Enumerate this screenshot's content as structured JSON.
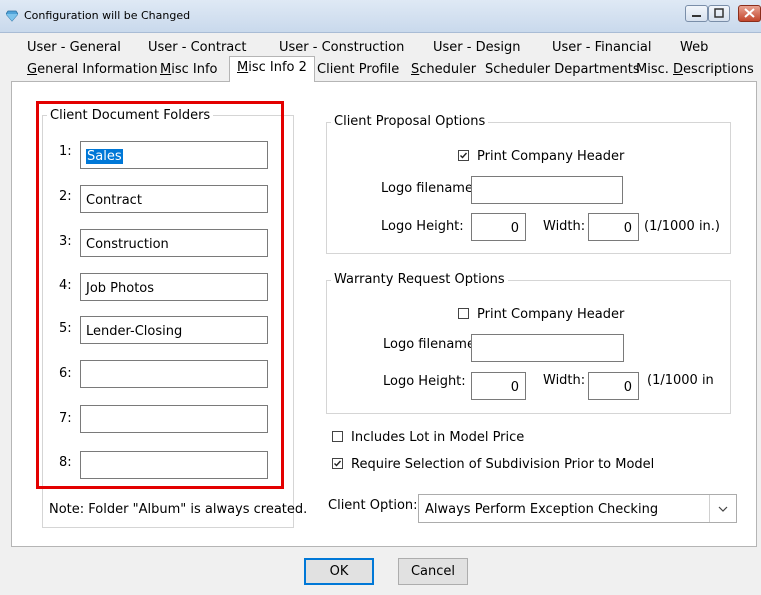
{
  "window": {
    "title": "Configuration will be Changed"
  },
  "tabs_row1": [
    "User - General",
    "User - Contract",
    "User - Construction",
    "User - Design",
    "User - Financial",
    "Web"
  ],
  "tabs_row2": [
    "General Information",
    "Misc Info",
    "Misc Info 2",
    "Client Profile",
    "Scheduler",
    "Scheduler Departments",
    "Misc. Descriptions"
  ],
  "active_tab": "Misc Info 2",
  "client_document_folders": {
    "title": "Client Document Folders",
    "folders": [
      {
        "num": "1:",
        "value": "Sales"
      },
      {
        "num": "2:",
        "value": "Contract"
      },
      {
        "num": "3:",
        "value": "Construction"
      },
      {
        "num": "4:",
        "value": "Job Photos"
      },
      {
        "num": "5:",
        "value": "Lender-Closing"
      },
      {
        "num": "6:",
        "value": ""
      },
      {
        "num": "7:",
        "value": ""
      },
      {
        "num": "8:",
        "value": ""
      }
    ],
    "note": "Note: Folder \"Album\" is always created."
  },
  "client_proposal": {
    "title": "Client Proposal Options",
    "print_header_label": "Print Company Header",
    "print_header_checked": true,
    "logo_filename_label": "Logo filename:",
    "logo_filename": "",
    "logo_height_label": "Logo Height:",
    "logo_height": "0",
    "width_label": "Width:",
    "width": "0",
    "unit": "(1/1000 in.)"
  },
  "warranty_request": {
    "title": "Warranty Request Options",
    "print_header_label": "Print Company Header",
    "print_header_checked": false,
    "logo_filename_label": "Logo filename:",
    "logo_filename": "",
    "logo_height_label": "Logo Height:",
    "logo_height": "0",
    "width_label": "Width:",
    "width": "0",
    "unit": "(1/1000 in"
  },
  "options": {
    "includes_lot_label": "Includes Lot in Model Price",
    "includes_lot_checked": false,
    "require_subdivision_label": "Require Selection of Subdivision Prior to Model",
    "require_subdivision_checked": true
  },
  "client_option": {
    "label": "Client Option:",
    "value": "Always Perform Exception Checking"
  },
  "buttons": {
    "ok": "OK",
    "cancel": "Cancel"
  },
  "colors": {
    "highlight_border": "#e30000",
    "selection": "#0078d7"
  }
}
